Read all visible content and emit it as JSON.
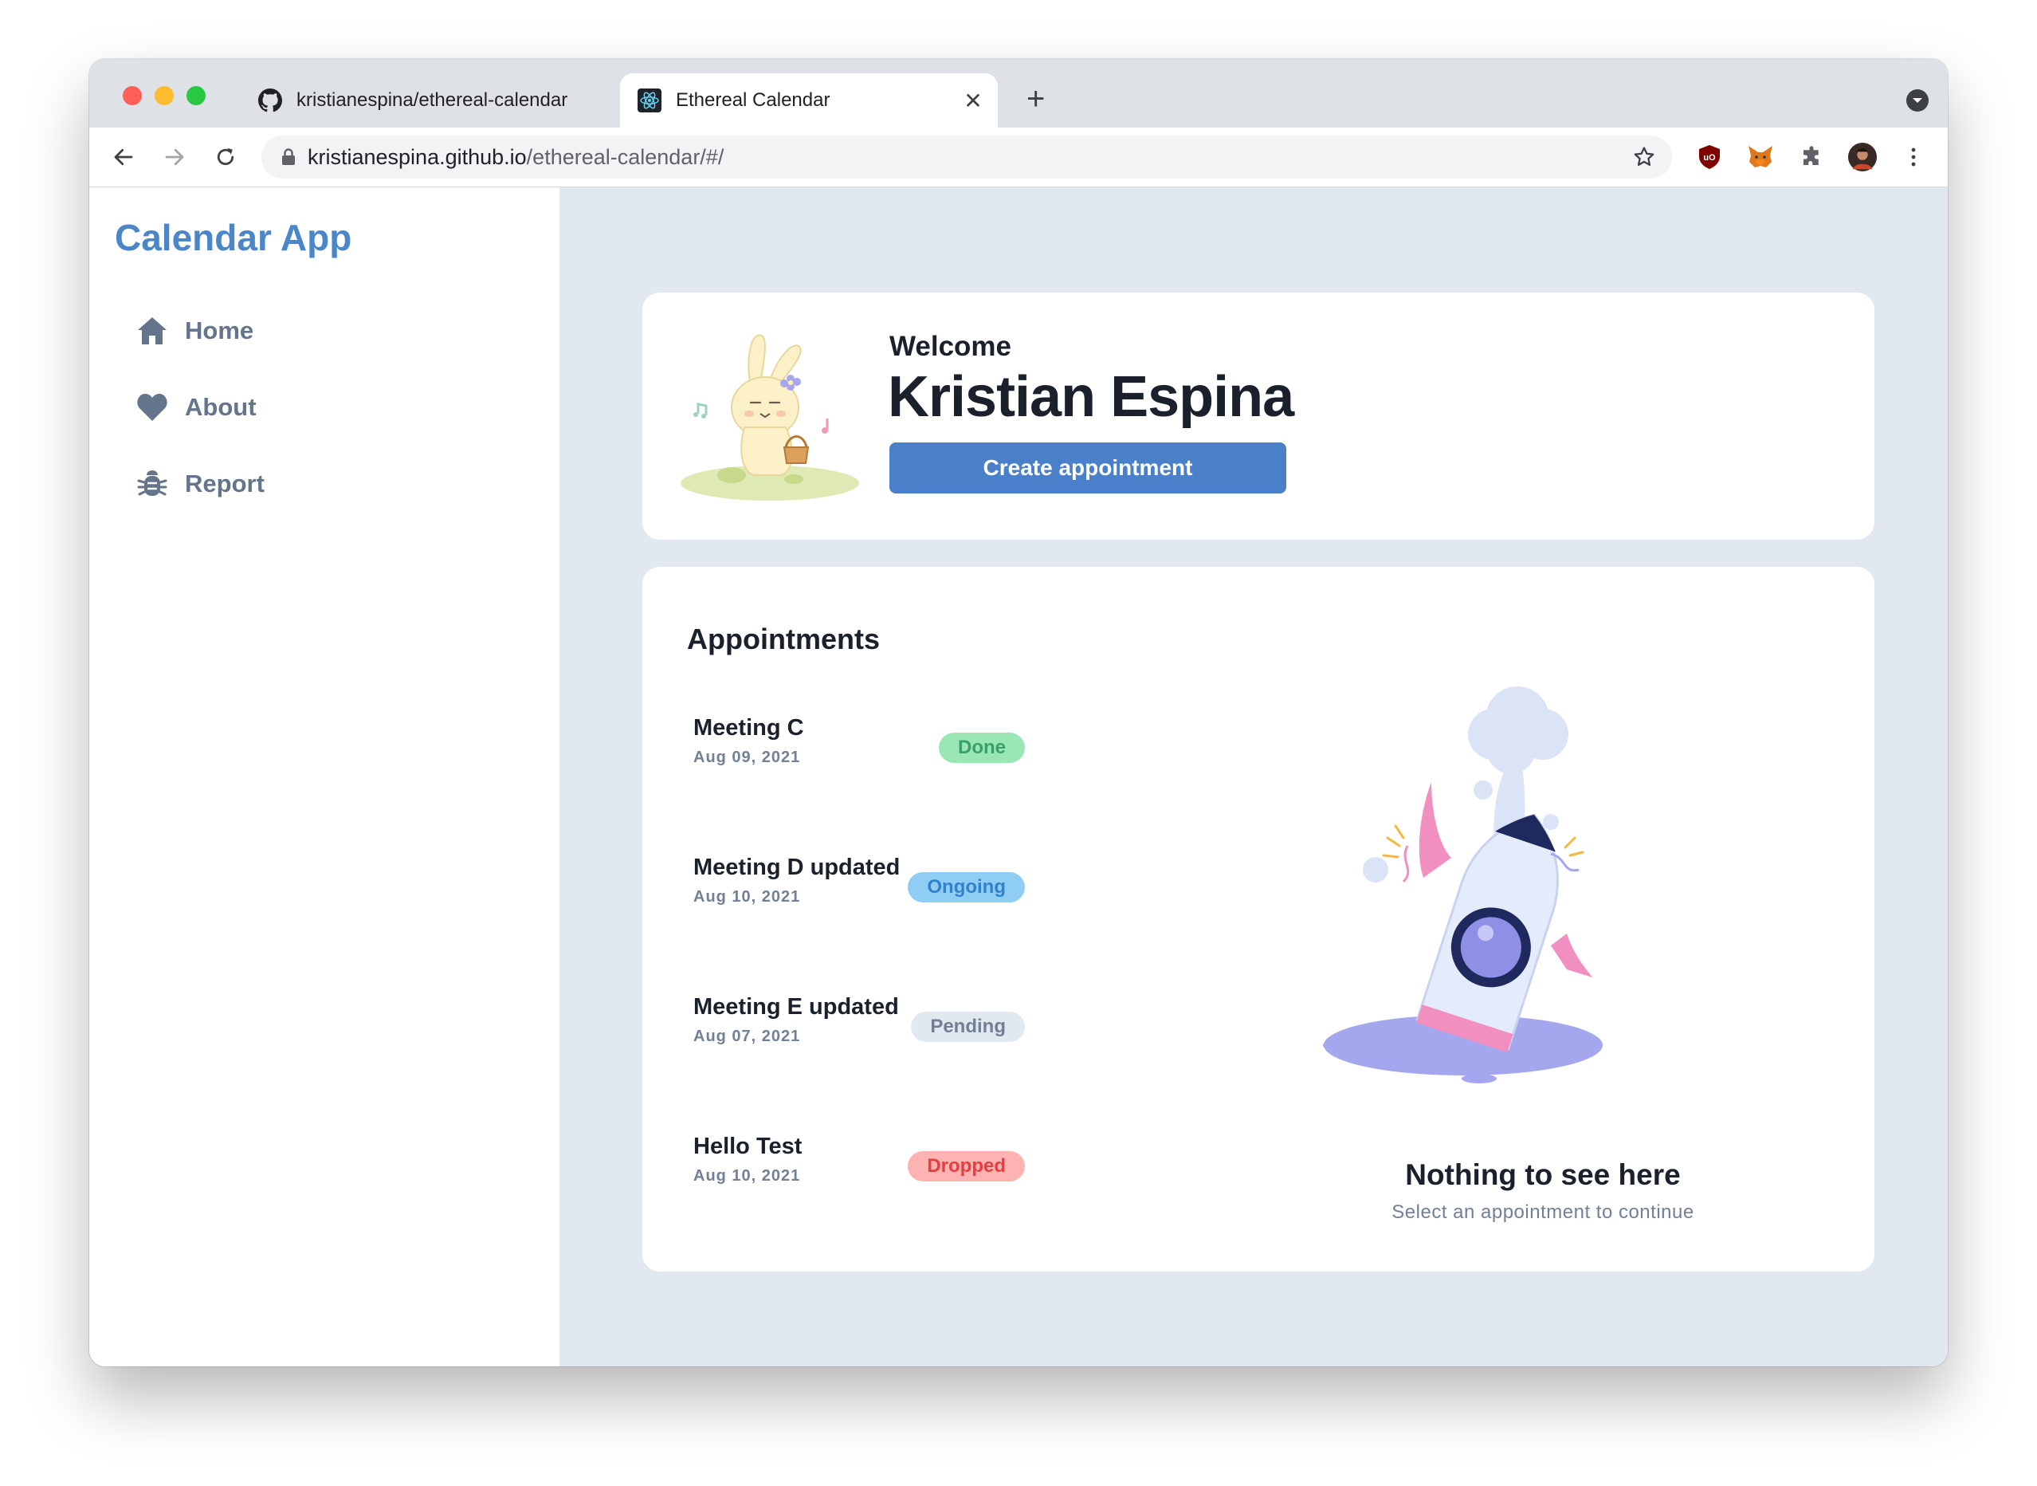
{
  "browser": {
    "tabs": [
      {
        "title": "kristianespina/ethereal-calendar",
        "active": false,
        "close": "✕"
      },
      {
        "title": "Ethereal Calendar",
        "active": true,
        "close": "✕"
      }
    ],
    "new_tab": "+",
    "url_host": "kristianespina.github.io",
    "url_path": "/ethereal-calendar/#/"
  },
  "sidebar": {
    "brand": "Calendar App",
    "items": [
      {
        "label": "Home",
        "icon": "home-icon"
      },
      {
        "label": "About",
        "icon": "heart-icon"
      },
      {
        "label": "Report",
        "icon": "bug-icon"
      }
    ]
  },
  "welcome": {
    "greeting": "Welcome",
    "name": "Kristian Espina",
    "create_label": "Create appointment"
  },
  "appointments": {
    "title": "Appointments",
    "items": [
      {
        "name": "Meeting C",
        "date": "Aug 09, 2021",
        "status": "Done",
        "badge_bg": "#9ae6b4",
        "badge_fg": "#38a169"
      },
      {
        "name": "Meeting D updated",
        "date": "Aug 10, 2021",
        "status": "Ongoing",
        "badge_bg": "#90cdf4",
        "badge_fg": "#3182ce"
      },
      {
        "name": "Meeting E updated",
        "date": "Aug 07, 2021",
        "status": "Pending",
        "badge_bg": "#e2e8f0",
        "badge_fg": "#718096"
      },
      {
        "name": "Hello Test",
        "date": "Aug 10, 2021",
        "status": "Dropped",
        "badge_bg": "#feb2b2",
        "badge_fg": "#e53e3e"
      }
    ],
    "empty_title": "Nothing to see here",
    "empty_subtitle": "Select an appointment to continue"
  },
  "colors": {
    "brand": "#4a86c8",
    "button": "#4a7fc9",
    "page_bg": "#e2e8f0"
  }
}
